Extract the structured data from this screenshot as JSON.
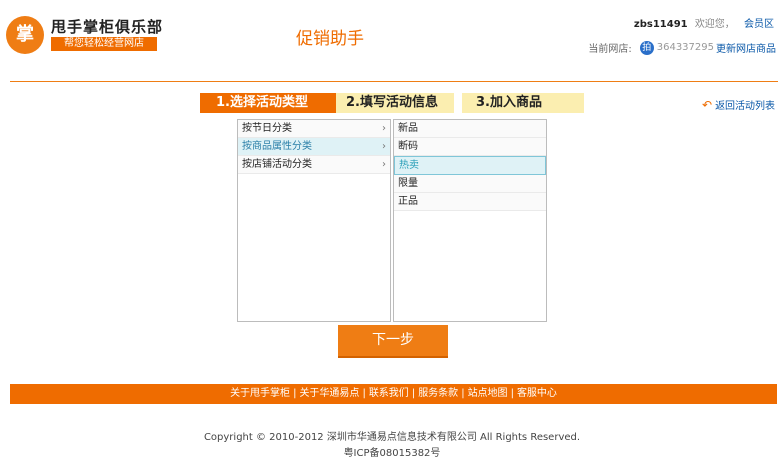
{
  "header": {
    "logo_char": "掌",
    "logo_title": "甩手掌柜俱乐部",
    "logo_subtitle": "帮您轻松经营网店",
    "page_title": "促销助手",
    "username": "zbs11491",
    "welcome": "欢迎您，",
    "member_link": "会员区",
    "store_label": "当前网店:",
    "store_badge": "拍",
    "store_id": "364337295",
    "change_store": "更新网店商品"
  },
  "steps": [
    {
      "label": "1.选择活动类型",
      "active": true
    },
    {
      "label": "2.填写活动信息",
      "active": false
    },
    {
      "label": "3.加入商品",
      "active": false
    }
  ],
  "back_link": "返回活动列表",
  "left_list": [
    {
      "label": "按节日分类",
      "chevron": "›"
    },
    {
      "label": "按商品属性分类",
      "chevron": "›"
    },
    {
      "label": "按店铺活动分类",
      "chevron": "›"
    }
  ],
  "right_list": [
    {
      "label": "新品"
    },
    {
      "label": "断码"
    },
    {
      "label": "热卖"
    },
    {
      "label": "限量"
    },
    {
      "label": "正品"
    }
  ],
  "next_button": "下一步",
  "footer_links": [
    "关于甩手掌柜",
    "关于华通易点",
    "联系我们",
    "服务条款",
    "站点地图",
    "客服中心"
  ],
  "footer_sep": "|",
  "copyright": "Copyright © 2010-2012 深圳市华通易点信息技术有限公司  All Rights Reserved.",
  "icp": "粤ICP备08015382号",
  "colors": {
    "accent": "#ef6c00",
    "step_inactive": "#fbeeb0",
    "link": "#0a58a8",
    "selected_bg": "#dff2f6"
  }
}
